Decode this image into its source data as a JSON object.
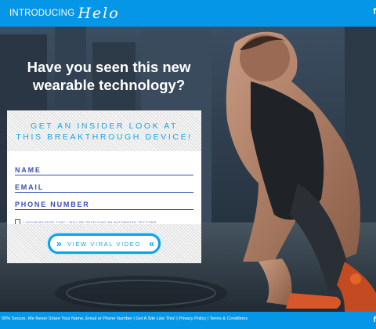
{
  "header": {
    "logo_intro": "INTRODUCING",
    "logo_brand": "Helo",
    "social_icon": "facebook-icon",
    "social_glyph": "f"
  },
  "hero": {
    "headline_line1": "Have you seen this new",
    "headline_line2": "wearable technology?"
  },
  "form": {
    "heading_line1": "GET AN INSIDER LOOK AT",
    "heading_line2": "THIS BREAKTHROUGH DEVICE!",
    "field_name": "NAME",
    "field_email": "EMAIL",
    "field_phone": "PHONE NUMBER",
    "consent_text": "I ACKNOWLEDGE THAT I WILL BE RECEIVING AN AUTOMATED TEXT/SMS",
    "cta_label": "VIEW VIRAL VIDEO",
    "cta_left_icon": "double-chevron-right-icon",
    "cta_right_icon": "double-chevron-left-icon",
    "cta_left_glyph": "»",
    "cta_right_glyph": "«"
  },
  "footer": {
    "text": "00% Secure. We Never Share Your Name, Email or Phone Number | Get A Site Like This! | Privacy Policy | Terms & Conditions",
    "social_glyph": "f"
  },
  "colors": {
    "brand_blue": "#0596e8",
    "form_accent": "#1aa4e6",
    "field_line": "#3a4fb0"
  }
}
